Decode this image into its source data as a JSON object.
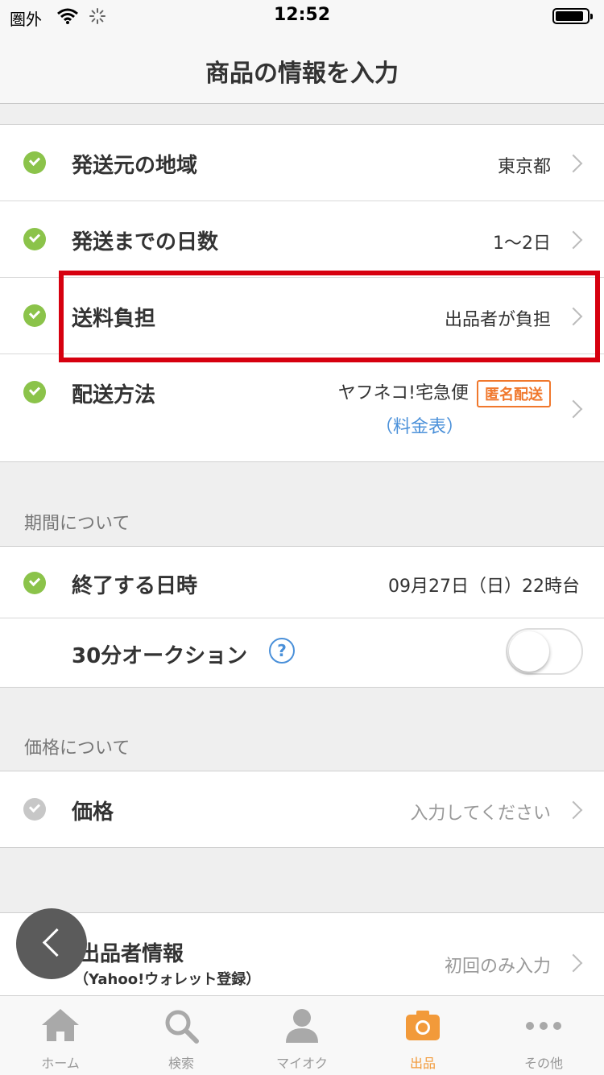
{
  "status_bar": {
    "carrier": "圏外",
    "time": "12:52"
  },
  "nav": {
    "title": "商品の情報を入力"
  },
  "shipping": {
    "rows": [
      {
        "label": "発送元の地域",
        "value": "東京都"
      },
      {
        "label": "発送までの日数",
        "value": "1〜2日"
      },
      {
        "label": "送料負担",
        "value": "出品者が負担"
      },
      {
        "label": "配送方法",
        "value": "ヤフネコ!宅急便",
        "badge": "匿名配送",
        "link": "（料金表）"
      }
    ]
  },
  "period": {
    "title": "期間について",
    "end_label": "終了する日時",
    "end_value": "09月27日（日）22時台",
    "auction_label": "30分オークション",
    "help": "?"
  },
  "price": {
    "title": "価格について",
    "label": "価格",
    "placeholder": "入力してください"
  },
  "seller": {
    "label": "出品者情報",
    "sublabel": "（Yahoo!ウォレット登録）",
    "value": "初回のみ入力"
  },
  "tabs": [
    {
      "label": "ホーム",
      "icon": "home-icon"
    },
    {
      "label": "検索",
      "icon": "search-icon"
    },
    {
      "label": "マイオク",
      "icon": "person-icon"
    },
    {
      "label": "出品",
      "icon": "camera-icon",
      "active": true
    },
    {
      "label": "その他",
      "icon": "more-icon"
    }
  ],
  "colors": {
    "check_green": "#8bc34a",
    "highlight_red": "#d6000f",
    "accent_orange": "#f29a3a",
    "link_blue": "#4a90d9"
  }
}
